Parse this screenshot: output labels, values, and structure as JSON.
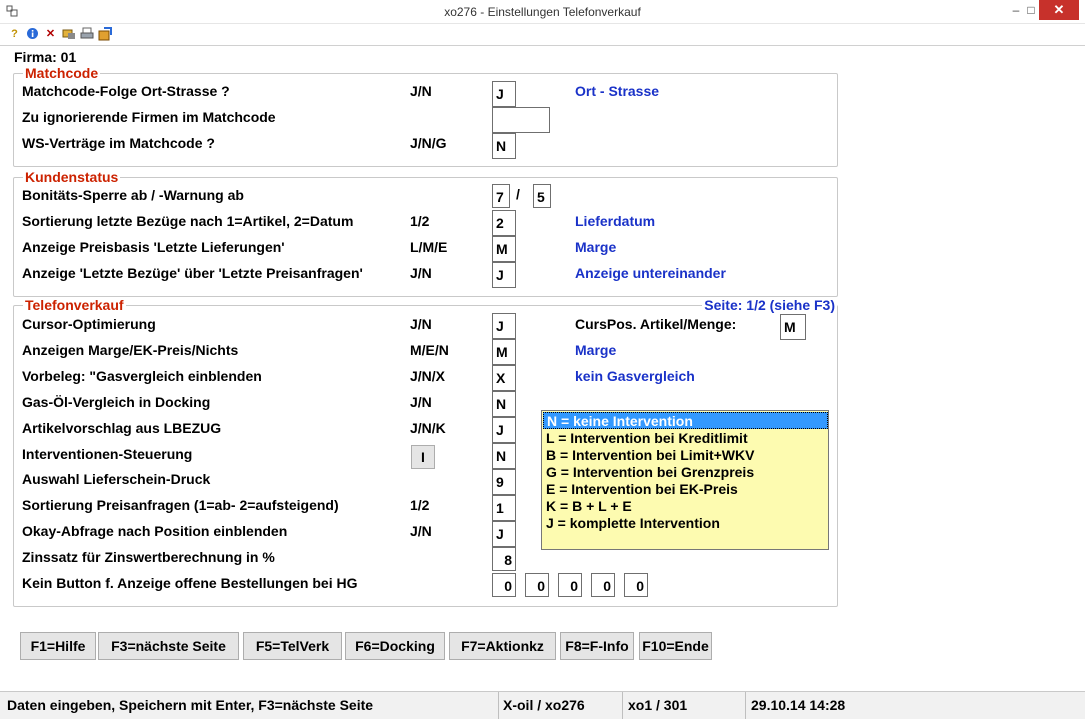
{
  "window": {
    "title": "xo276 - Einstellungen Telefonverkauf",
    "minimize": "–",
    "maximize": "□",
    "close": "✕"
  },
  "firma": "Firma: 01",
  "matchcode": {
    "legend": "Matchcode",
    "rows": [
      {
        "label": "Matchcode-Folge Ort-Strasse ?",
        "hint": "J/N",
        "value": "J",
        "desc": "Ort - Strasse"
      },
      {
        "label": "Zu ignorierende Firmen im Matchcode",
        "hint": "",
        "value": "",
        "desc": ""
      },
      {
        "label": "WS-Verträge im Matchcode ?",
        "hint": "J/N/G",
        "value": "N",
        "desc": ""
      }
    ]
  },
  "kundenstatus": {
    "legend": "Kundenstatus",
    "rows": [
      {
        "label": "Bonitäts-Sperre ab / -Warnung ab",
        "hint": "",
        "value": "7",
        "value2": "5",
        "sep": "/",
        "desc": ""
      },
      {
        "label": "Sortierung letzte Bezüge nach 1=Artikel, 2=Datum",
        "hint": "1/2",
        "value": "2",
        "desc": "Lieferdatum"
      },
      {
        "label": "Anzeige Preisbasis 'Letzte Lieferungen'",
        "hint": "L/M/E",
        "value": "M",
        "desc": "Marge"
      },
      {
        "label": "Anzeige 'Letzte Bezüge' über 'Letzte Preisanfragen'",
        "hint": "J/N",
        "value": "J",
        "desc": "Anzeige untereinander"
      }
    ]
  },
  "telefonverkauf": {
    "legend": "Telefonverkauf",
    "page_info": "Seite: 1/2 (siehe F3)",
    "curspos_label": "CursPos. Artikel/Menge:",
    "curspos_value": "M",
    "rows": [
      {
        "label": "Cursor-Optimierung",
        "hint": "J/N",
        "value": "J",
        "desc": ""
      },
      {
        "label": "Anzeigen Marge/EK-Preis/Nichts",
        "hint": "M/E/N",
        "value": "M",
        "desc": "Marge"
      },
      {
        "label": "Vorbeleg: \"Gasvergleich einblenden",
        "hint": "J/N/X",
        "value": "X",
        "desc": "kein Gasvergleich"
      },
      {
        "label": "Gas-Öl-Vergleich in Docking",
        "hint": "J/N",
        "value": "N",
        "desc": ""
      },
      {
        "label": "Artikelvorschlag aus LBEZUG",
        "hint": "J/N/K",
        "value": "J",
        "desc": ""
      },
      {
        "label": "Interventionen-Steuerung",
        "hint": "",
        "value": "N",
        "desc": ""
      },
      {
        "label": "Auswahl Lieferschein-Druck",
        "hint": "",
        "value": "9",
        "desc": ""
      },
      {
        "label": "Sortierung Preisanfragen (1=ab- 2=aufsteigend)",
        "hint": "1/2",
        "value": "1",
        "desc": ""
      },
      {
        "label": "Okay-Abfrage nach Position einblenden",
        "hint": "J/N",
        "value": "J",
        "desc": ""
      },
      {
        "label": "Zinssatz für Zinswertberechnung in %",
        "hint": "",
        "value": "8",
        "desc": ""
      },
      {
        "label": "Kein Button f. Anzeige offene Bestellungen bei HG",
        "hint": "",
        "value": "",
        "desc": ""
      }
    ],
    "hg_values": [
      "0",
      "0",
      "0",
      "0",
      "0"
    ],
    "intervention_button": "I",
    "intervention_options": [
      "N = keine Intervention",
      "L = Intervention bei Kreditlimit",
      "B = Intervention bei Limit+WKV",
      "G = Intervention bei Grenzpreis",
      "E = Intervention bei EK-Preis",
      "K = B + L + E",
      "J = komplette Intervention"
    ],
    "intervention_selected": "N = keine Intervention"
  },
  "function_keys": [
    "F1=Hilfe",
    "F3=nächste Seite",
    "F5=TelVerk",
    "F6=Docking",
    "F7=Aktionkz",
    "F8=F-Info",
    "F10=Ende"
  ],
  "statusbar": {
    "message": "Daten eingeben, Speichern mit Enter, F3=nächste Seite",
    "system": "X-oil / xo276",
    "user": "xo1 / 301",
    "datetime": "29.10.14 14:28"
  },
  "colors": {
    "legend": "#cc2200",
    "desc": "#1a32c8",
    "listbox": "#fdfbb0",
    "selected": "#3399ff",
    "close": "#c7312b"
  },
  "icons": [
    "app-icon",
    "help-icon",
    "info-icon",
    "cancel-icon",
    "tools-icon",
    "print-icon",
    "export-icon"
  ]
}
